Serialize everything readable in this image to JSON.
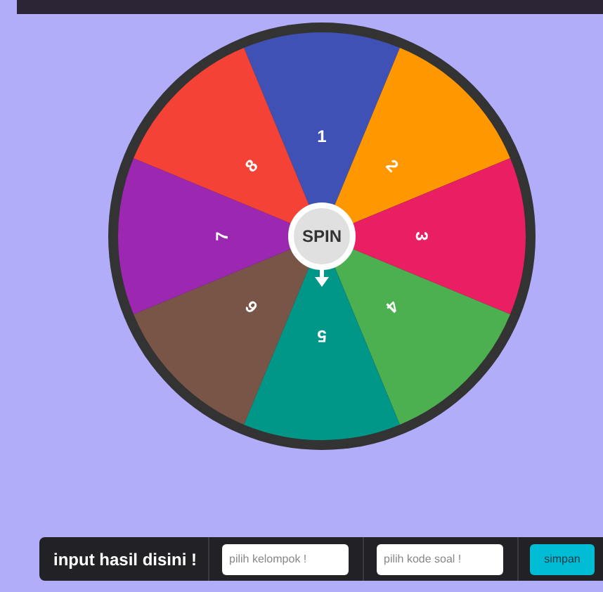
{
  "wheel": {
    "segments": [
      {
        "label": "1",
        "color": "#3f51b5"
      },
      {
        "label": "2",
        "color": "#ff9800"
      },
      {
        "label": "3",
        "color": "#e91e63"
      },
      {
        "label": "4",
        "color": "#4caf50"
      },
      {
        "label": "5",
        "color": "#009688"
      },
      {
        "label": "6",
        "color": "#795548"
      },
      {
        "label": "7",
        "color": "#9c27b0"
      },
      {
        "label": "8",
        "color": "#f44336"
      }
    ],
    "spin_button": "SPIN"
  },
  "input_bar": {
    "label": "input hasil disini !",
    "group_field": {
      "placeholder": "pilih kelompok !"
    },
    "code_field": {
      "placeholder": "pilih kode soal !"
    },
    "save_button": "simpan"
  }
}
